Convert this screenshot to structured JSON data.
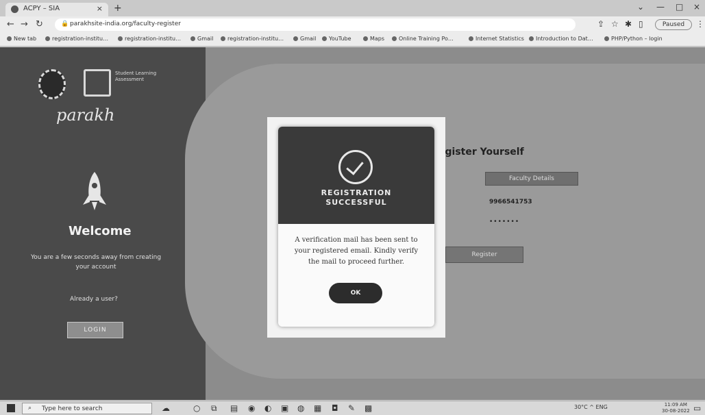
{
  "browser": {
    "tab_title": "ACPY – SIA",
    "tab_close": "×",
    "new_tab": "+",
    "url": "parakhsite-india.org/faculty-register",
    "profile_label": "Paused",
    "window_controls": [
      "⌄",
      "—",
      "□",
      "×"
    ],
    "bookmarks": [
      "New tab",
      "registration-institu…",
      "registration-institu…",
      "Gmail",
      "registration-institu…",
      "Gmail",
      "YouTube",
      "Maps",
      "Online Training Po…",
      "Internet Statistics",
      "Introduction to Dat…",
      "PHP/Python – login"
    ]
  },
  "left_panel": {
    "logo_text": "Student Learning Assessment",
    "brand": "parakh",
    "welcome": "Welcome",
    "subtitle": "You are a few seconds away from creating your account",
    "already": "Already a user?",
    "login_label": "LOGIN"
  },
  "form": {
    "title": "egister Yourself",
    "faculty_select": "Faculty Details",
    "phone": "9966541753",
    "password": "•••••••",
    "register_label": "Register"
  },
  "modal": {
    "title_line1": "REGISTRATION",
    "title_line2": "SUCCESSFUL",
    "message": "A verification mail has been sent to your registered email. Kindly verify the mail to proceed further.",
    "ok_label": "OK"
  },
  "taskbar": {
    "search_placeholder": "Type here to search",
    "tray_text": "30°C  ^  ENG",
    "time": "11:09 AM",
    "date": "30-08-2022"
  }
}
